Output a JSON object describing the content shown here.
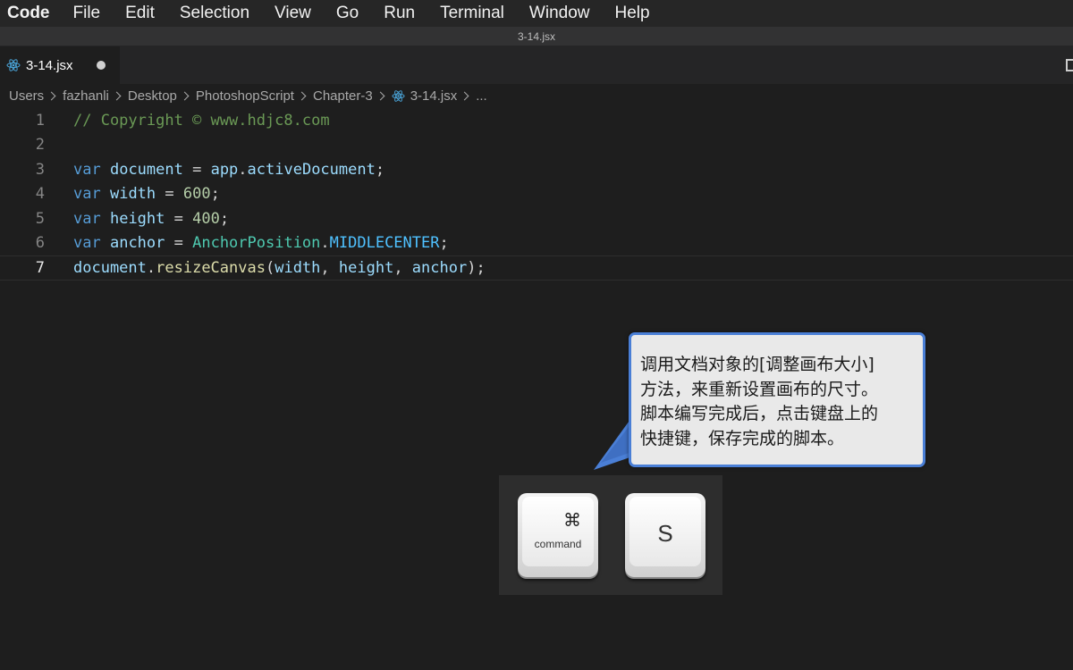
{
  "menubar": {
    "app": "Code",
    "items": [
      "File",
      "Edit",
      "Selection",
      "View",
      "Go",
      "Run",
      "Terminal",
      "Window",
      "Help"
    ]
  },
  "window": {
    "title": "3-14.jsx"
  },
  "tab": {
    "label": "3-14.jsx",
    "icon": "react-icon",
    "modified": true
  },
  "breadcrumb": {
    "items": [
      "Users",
      "fazhanli",
      "Desktop",
      "PhotoshopScript",
      "Chapter-3"
    ],
    "file": "3-14.jsx",
    "more": "..."
  },
  "editor": {
    "current_line": 7,
    "lines": [
      {
        "number": "1",
        "tokens": [
          {
            "t": "// Copyright © www.hdjc8.com",
            "c": "comment"
          }
        ]
      },
      {
        "number": "2",
        "tokens": []
      },
      {
        "number": "3",
        "tokens": [
          {
            "t": "var",
            "c": "kw"
          },
          {
            "t": " ",
            "c": "punc"
          },
          {
            "t": "document",
            "c": "var"
          },
          {
            "t": " = ",
            "c": "punc"
          },
          {
            "t": "app",
            "c": "var"
          },
          {
            "t": ".",
            "c": "punc"
          },
          {
            "t": "activeDocument",
            "c": "var"
          },
          {
            "t": ";",
            "c": "punc"
          }
        ]
      },
      {
        "number": "4",
        "tokens": [
          {
            "t": "var",
            "c": "kw"
          },
          {
            "t": " ",
            "c": "punc"
          },
          {
            "t": "width",
            "c": "var"
          },
          {
            "t": " = ",
            "c": "punc"
          },
          {
            "t": "600",
            "c": "num"
          },
          {
            "t": ";",
            "c": "punc"
          }
        ]
      },
      {
        "number": "5",
        "tokens": [
          {
            "t": "var",
            "c": "kw"
          },
          {
            "t": " ",
            "c": "punc"
          },
          {
            "t": "height",
            "c": "var"
          },
          {
            "t": " = ",
            "c": "punc"
          },
          {
            "t": "400",
            "c": "num"
          },
          {
            "t": ";",
            "c": "punc"
          }
        ]
      },
      {
        "number": "6",
        "tokens": [
          {
            "t": "var",
            "c": "kw"
          },
          {
            "t": " ",
            "c": "punc"
          },
          {
            "t": "anchor",
            "c": "var"
          },
          {
            "t": " = ",
            "c": "punc"
          },
          {
            "t": "AnchorPosition",
            "c": "cls"
          },
          {
            "t": ".",
            "c": "punc"
          },
          {
            "t": "MIDDLECENTER",
            "c": "const"
          },
          {
            "t": ";",
            "c": "punc"
          }
        ]
      },
      {
        "number": "7",
        "tokens": [
          {
            "t": "document",
            "c": "var"
          },
          {
            "t": ".",
            "c": "punc"
          },
          {
            "t": "resizeCanvas",
            "c": "fn"
          },
          {
            "t": "(",
            "c": "punc"
          },
          {
            "t": "width",
            "c": "var"
          },
          {
            "t": ", ",
            "c": "punc"
          },
          {
            "t": "height",
            "c": "var"
          },
          {
            "t": ", ",
            "c": "punc"
          },
          {
            "t": "anchor",
            "c": "var"
          },
          {
            "t": ");",
            "c": "punc"
          }
        ]
      }
    ]
  },
  "callout": {
    "lines": [
      "调用文档对象的[调整画布大小]",
      "方法，来重新设置画布的尺寸。",
      "脚本编写完成后，点击键盘上的",
      "快捷键，保存完成的脚本。"
    ]
  },
  "shortcut": {
    "command_glyph": "⌘",
    "command_label": "command",
    "key": "S"
  },
  "colors": {
    "background": "#1e1e1e",
    "comment": "#6a9955",
    "keyword": "#569cd6",
    "variable": "#9cdcfe",
    "number": "#b5cea8",
    "function": "#dcdcaa",
    "class": "#4ec9b0",
    "constant": "#4fc1ff",
    "callout_border": "#4a7fd6"
  }
}
